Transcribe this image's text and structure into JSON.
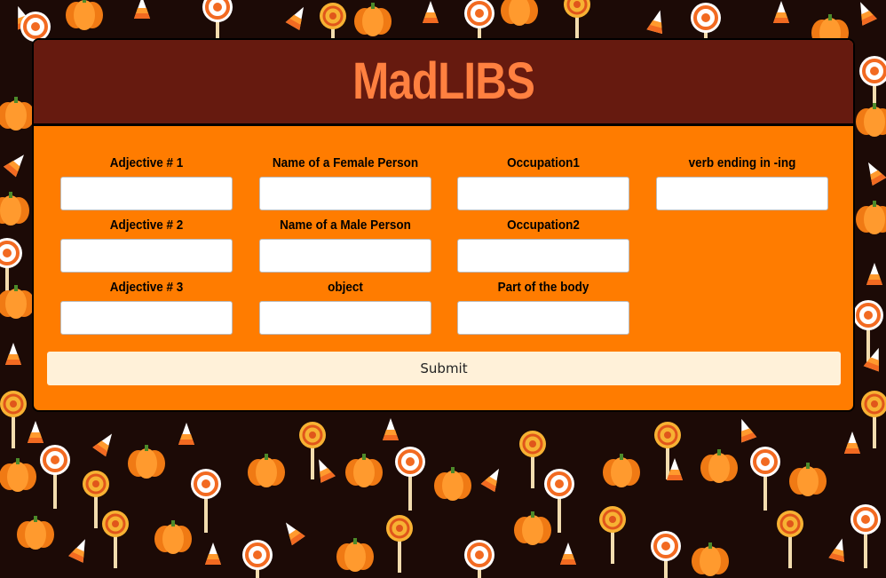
{
  "header": {
    "title": "MadLIBS"
  },
  "fields": [
    {
      "label": "Adjective # 1",
      "value": ""
    },
    {
      "label": "Name of a Female Person",
      "value": ""
    },
    {
      "label": "Occupation1",
      "value": ""
    },
    {
      "label": "verb ending in -ing",
      "value": ""
    },
    {
      "label": "Adjective # 2",
      "value": ""
    },
    {
      "label": "Name of a Male Person",
      "value": ""
    },
    {
      "label": "Occupation2",
      "value": ""
    },
    {
      "label": "Adjective # 3",
      "value": ""
    },
    {
      "label": "object",
      "value": ""
    },
    {
      "label": "Part of the body",
      "value": ""
    }
  ],
  "submit_label": "Submit",
  "colors": {
    "background": "#1c0a06",
    "header": "#661a0f",
    "title": "#ff8040",
    "form": "#ff7c00",
    "submit": "#fff1d9"
  },
  "background_icons": [
    "pumpkin-icon",
    "lollipop-icon",
    "candy-corn-icon",
    "swirl-candy-icon"
  ]
}
